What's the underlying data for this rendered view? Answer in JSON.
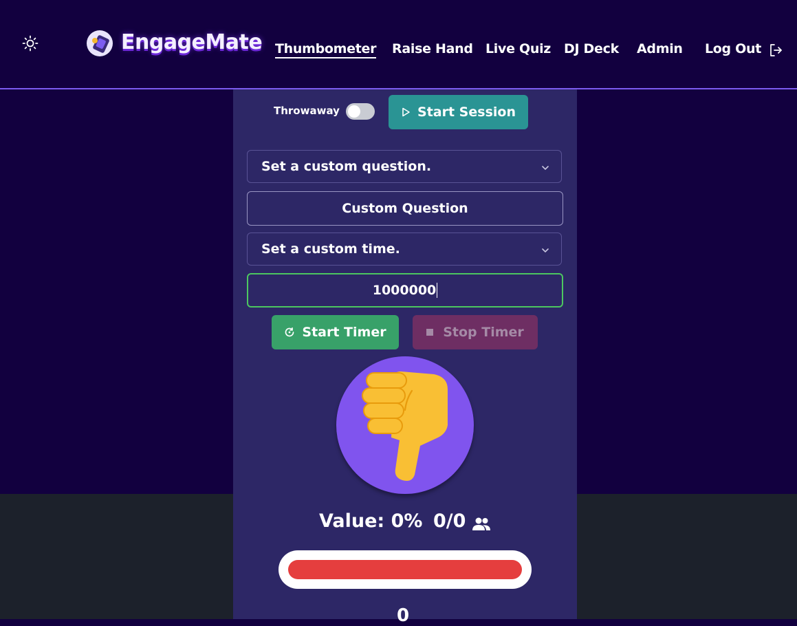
{
  "header": {
    "brand": "EngageMate",
    "nav": [
      {
        "label": "Thumbometer",
        "active": true
      },
      {
        "label": "Raise Hand",
        "active": false
      },
      {
        "label": "Live Quiz",
        "active": false
      },
      {
        "label": "DJ Deck",
        "active": false
      },
      {
        "label": "Admin",
        "active": false
      }
    ],
    "logout_label": "Log Out",
    "theme_icon": "sun-icon",
    "logout_icon": "logout-icon"
  },
  "session": {
    "throwaway_label": "Throwaway",
    "throwaway_enabled": false,
    "start_session_label": "Start Session"
  },
  "question": {
    "select_label": "Set a custom question.",
    "custom_value": "Custom Question"
  },
  "time": {
    "select_label": "Set a custom time.",
    "input_value": "1000000"
  },
  "timer": {
    "start_label": "Start Timer",
    "stop_label": "Stop Timer"
  },
  "meter": {
    "value_text": "Value: 0%",
    "count_text": "0/0",
    "value_percent": 0,
    "fill_fraction": 1.0,
    "thumb_icon": "thumbs-down-icon",
    "bottom_number": "0"
  },
  "colors": {
    "background": "#12003f",
    "panel": "#2d2766",
    "accent": "#7c5cf0",
    "session_button": "#2a9494",
    "start_timer": "#38a169",
    "stop_timer": "#6e2e63",
    "meter_fill": "#e53e3e"
  }
}
